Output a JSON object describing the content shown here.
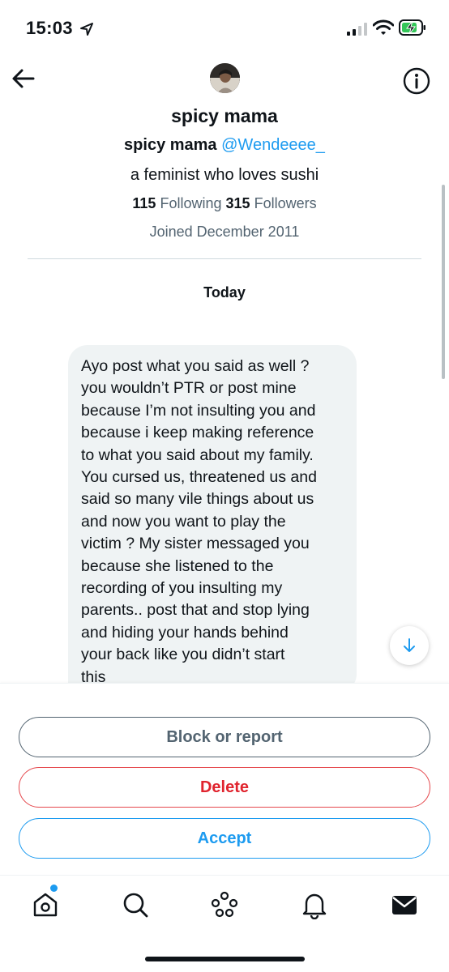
{
  "status_bar": {
    "time": "15:03",
    "icons": [
      "location-arrow-icon",
      "cellular-signal-icon",
      "wifi-icon",
      "battery-charging-icon"
    ],
    "battery_color": "#34c759"
  },
  "header": {
    "back_icon": "arrow-left-icon",
    "info_icon": "info-circle-icon"
  },
  "profile": {
    "display_name": "spicy mama",
    "name_inline": "spicy mama",
    "handle": "@Wendeeee_",
    "bio": "a feminist who loves sushi",
    "following_count": "115",
    "following_label": "Following",
    "followers_count": "315",
    "followers_label": "Followers",
    "joined": "Joined December 2011"
  },
  "conversation": {
    "date_separator": "Today",
    "messages": [
      {
        "text": "Ayo post what you said as well ?\nyou wouldn’t PTR or post mine\nbecause I’m not insulting you and\nbecause i keep making reference\nto what you said about my family.\nYou cursed us, threatened us and\nsaid so many vile things about us\nand now you want to play the\nvictim ? My sister messaged you\nbecause she listened to the\nrecording of you insulting my\nparents.. post that and stop lying\nand hiding your hands behind\nyour back like you didn’t start\nthis"
      }
    ]
  },
  "actions": {
    "block_or_report": "Block or report",
    "delete": "Delete",
    "accept": "Accept"
  },
  "colors": {
    "accent": "#1d9bf0",
    "danger": "#e0242e",
    "muted": "#536471",
    "bubble": "#eff3f4"
  },
  "tab_bar": {
    "items": [
      "home-icon",
      "search-icon",
      "spaces-icon",
      "notifications-icon",
      "messages-icon"
    ],
    "home_has_badge": true
  }
}
